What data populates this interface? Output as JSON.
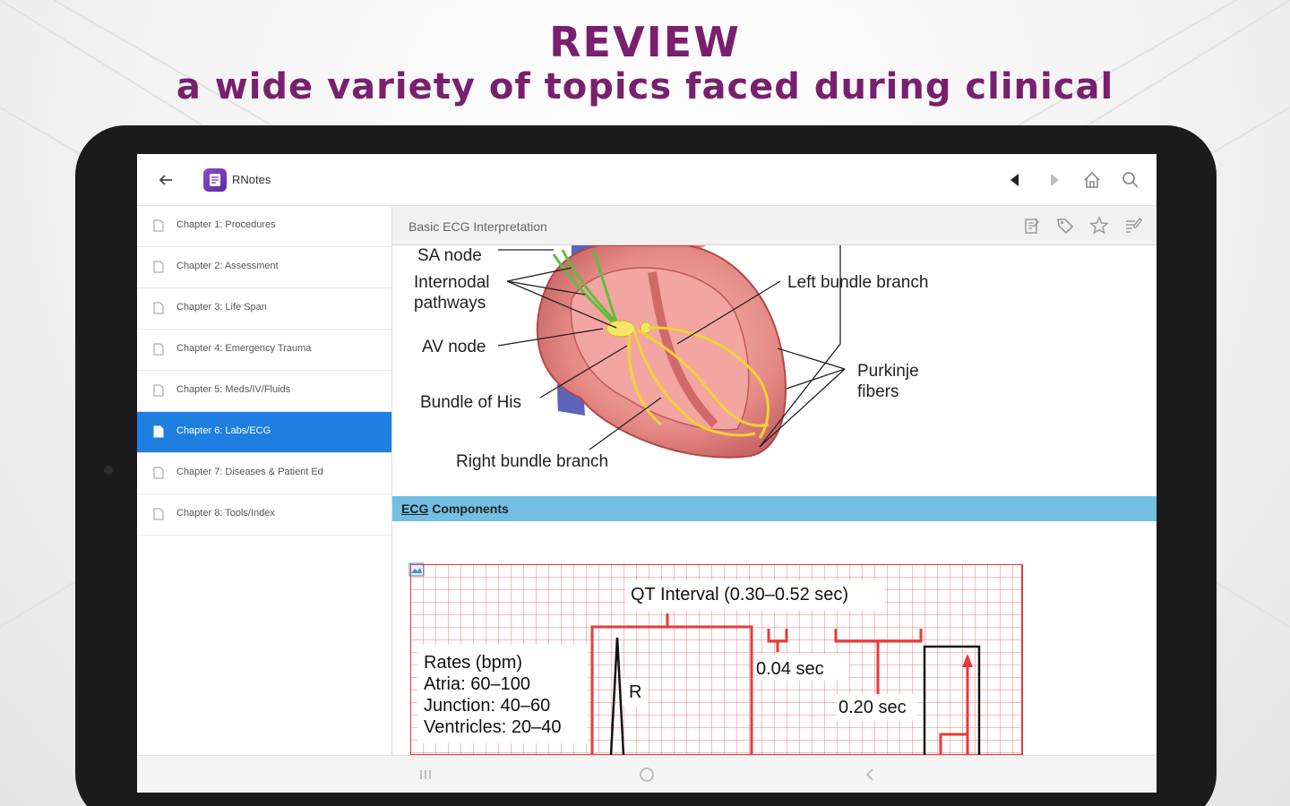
{
  "promo": {
    "headline": "REVIEW",
    "subline": "a wide variety of topics faced during clinical"
  },
  "app": {
    "name": "RNotes",
    "colors": {
      "brand_purple": "#78206e",
      "active_blue": "#1e7fe0",
      "section_bar": "#72bfe2",
      "ecg_red": "#e83a3a"
    }
  },
  "toolbar": {
    "icons": [
      "back-arrow-icon",
      "prev-triangle-icon",
      "next-triangle-icon",
      "home-icon",
      "search-icon"
    ]
  },
  "sidebar": {
    "items": [
      {
        "label": "Chapter 1: Procedures",
        "active": false
      },
      {
        "label": "Chapter 2: Assessment",
        "active": false
      },
      {
        "label": "Chapter 3: Life Span",
        "active": false
      },
      {
        "label": "Chapter 4: Emergency Trauma",
        "active": false
      },
      {
        "label": "Chapter 5: Meds/IV/Fluids",
        "active": false
      },
      {
        "label": "Chapter 6: Labs/ECG",
        "active": true
      },
      {
        "label": "Chapter 7: Diseases & Patient Ed",
        "active": false
      },
      {
        "label": "Chapter 8: Tools/Index",
        "active": false
      }
    ]
  },
  "content": {
    "title": "Basic ECG Interpretation",
    "header_icons": [
      "notes-icon",
      "tag-icon",
      "star-icon",
      "list-edit-icon"
    ],
    "heart_diagram": {
      "labels": {
        "sa_node": "SA node",
        "internodal": "Internodal\npathways",
        "av_node": "AV node",
        "bundle_his": "Bundle of His",
        "right_bundle": "Right bundle branch",
        "left_bundle": "Left bundle branch",
        "purkinje": "Purkinje\nfibers"
      }
    },
    "section": {
      "abbr": "ECG",
      "rest": " Components"
    },
    "ecg_diagram": {
      "qt_interval": "QT Interval (0.30–0.52 sec)",
      "rates": "Rates (bpm)\nAtria: 60–100\nJunction: 40–60\nVentricles: 20–40",
      "r_label": "R",
      "sec_004": "0.04 sec",
      "sec_020": "0.20 sec"
    }
  },
  "navbar": {
    "icons": [
      "recent-apps-icon",
      "home-circle-icon",
      "back-chevron-icon"
    ]
  }
}
